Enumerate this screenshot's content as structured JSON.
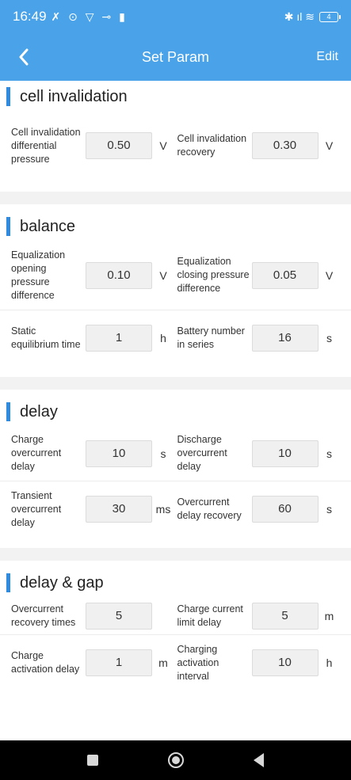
{
  "status_bar": {
    "time": "16:49",
    "left_icons": "✗ ⊙ ▽ ⊸ ▮",
    "right_icons": "✱ ıl ≋",
    "battery": "4"
  },
  "header": {
    "title": "Set Param",
    "edit_label": "Edit"
  },
  "sections": [
    {
      "title": "cell invalidation",
      "rows": [
        [
          {
            "label": "Cell invalidation differential pressure",
            "value": "0.50",
            "unit": "V"
          },
          {
            "label": "Cell invalidation recovery",
            "value": "0.30",
            "unit": "V"
          }
        ]
      ]
    },
    {
      "title": "balance",
      "rows": [
        [
          {
            "label": "Equalization opening pressure difference",
            "value": "0.10",
            "unit": "V"
          },
          {
            "label": "Equalization closing pressure difference",
            "value": "0.05",
            "unit": "V"
          }
        ],
        [
          {
            "label": "Static equilibrium time",
            "value": "1",
            "unit": "h"
          },
          {
            "label": "Battery number in series",
            "value": "16",
            "unit": "s"
          }
        ]
      ]
    },
    {
      "title": "delay",
      "rows": [
        [
          {
            "label": "Charge overcurrent delay",
            "value": "10",
            "unit": "s"
          },
          {
            "label": "Discharge overcurrent delay",
            "value": "10",
            "unit": "s"
          }
        ],
        [
          {
            "label": "Transient overcurrent delay",
            "value": "30",
            "unit": "ms"
          },
          {
            "label": "Overcurrent delay recovery",
            "value": "60",
            "unit": "s"
          }
        ]
      ]
    },
    {
      "title": "delay & gap",
      "rows": [
        [
          {
            "label": "Overcurrent recovery times",
            "value": "5",
            "unit": ""
          },
          {
            "label": "Charge current limit delay",
            "value": "5",
            "unit": "m"
          }
        ],
        [
          {
            "label": "Charge activation delay",
            "value": "1",
            "unit": "m"
          },
          {
            "label": "Charging activation interval",
            "value": "10",
            "unit": "h"
          }
        ]
      ]
    }
  ],
  "colors": {
    "header_bg": "#4aa3e8",
    "section_accent": "#2f8be0",
    "input_bg": "#f0f0f0"
  }
}
